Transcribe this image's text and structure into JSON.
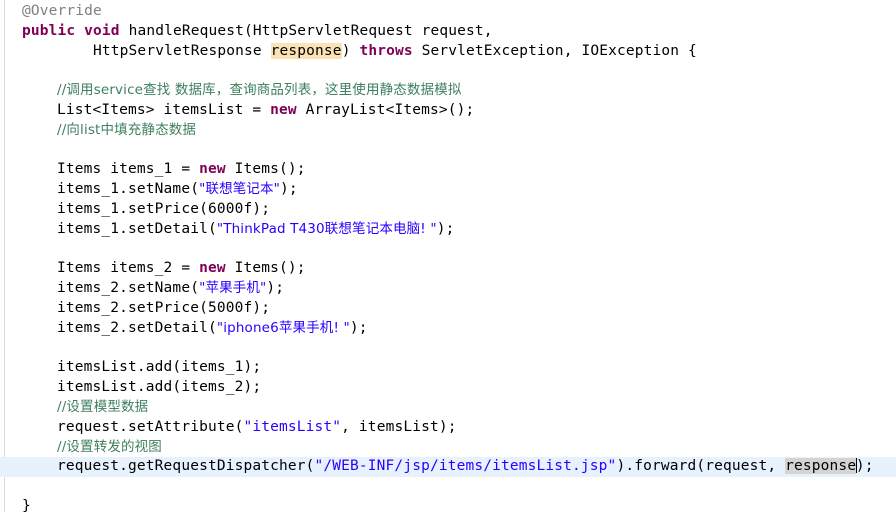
{
  "editor": {
    "kind": "java-source-editor",
    "theme": "eclipse-light",
    "current_line_background": "#e8f2fe",
    "colors": {
      "keyword": "#7f0055",
      "comment": "#3f7f5f",
      "string": "#2a00ff",
      "annotation": "#808080",
      "plain_text": "#000000",
      "occurrence_write": "#fbe3b6",
      "occurrence_read": "#d4d4d4",
      "background": "#ffffff"
    },
    "caret_visible": true
  },
  "code": {
    "annotation_override": "@Override",
    "signature": {
      "kw_public": "public",
      "kw_void": "void",
      "method": " handleRequest(HttpServletRequest request,",
      "indent2": "        HttpServletResponse ",
      "param_response": "response",
      "after_param": ") ",
      "kw_throws": "throws",
      "exceptions": " ServletException, IOException {"
    },
    "comment_service": "//调用service查找 数据库，查询商品列表，这里使用静态数据模拟",
    "list_decl_pre": "List<Items> itemsList = ",
    "kw_new": "new",
    "list_decl_post": " ArrayList<Items>();",
    "comment_fill_list": "//向list中填充静态数据",
    "items1": {
      "decl_pre": "Items items_1 = ",
      "decl_post": " Items();",
      "setname_pre": "items_1.setName(",
      "setname_str": "\"联想笔记本\"",
      "setname_post": ");",
      "setprice": "items_1.setPrice(6000f);",
      "setdetail_pre": "items_1.setDetail(",
      "setdetail_str": "\"ThinkPad T430联想笔记本电脑! \"",
      "setdetail_post": ");"
    },
    "items2": {
      "decl_pre": "Items items_2 = ",
      "decl_post": " Items();",
      "setname_pre": "items_2.setName(",
      "setname_str": "\"苹果手机\"",
      "setname_post": ");",
      "setprice": "items_2.setPrice(5000f);",
      "setdetail_pre": "items_2.setDetail(",
      "setdetail_str": "\"iphone6苹果手机! \"",
      "setdetail_post": ");"
    },
    "add1": "itemsList.add(items_1);",
    "add2": "itemsList.add(items_2);",
    "comment_model": "//设置模型数据",
    "set_attr_pre": "request.setAttribute(",
    "set_attr_str": "\"itemsList\"",
    "set_attr_post": ", itemsList);",
    "comment_view": "//设置转发的视图",
    "dispatch_pre": "request.getRequestDispatcher(",
    "dispatch_str": "\"/WEB-INF/jsp/items/itemsList.jsp\"",
    "dispatch_mid": ").forward(request, ",
    "dispatch_param": "response",
    "dispatch_post": ");",
    "closing_brace": "}"
  }
}
